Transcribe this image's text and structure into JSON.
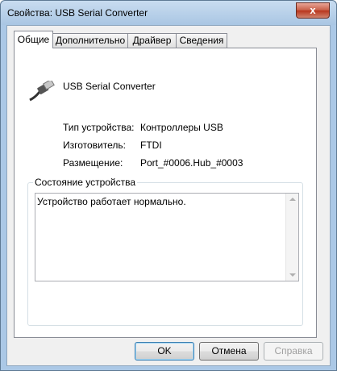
{
  "window": {
    "title": "Свойства: USB Serial Converter",
    "close_glyph": "x"
  },
  "tabs": [
    {
      "label": "Общие",
      "active": true
    },
    {
      "label": "Дополнительно",
      "active": false
    },
    {
      "label": "Драйвер",
      "active": false
    },
    {
      "label": "Сведения",
      "active": false
    }
  ],
  "device": {
    "name": "USB Serial Converter",
    "icon": "usb-plug-icon"
  },
  "properties": [
    {
      "label": "Тип устройства:",
      "value": "Контроллеры USB"
    },
    {
      "label": "Изготовитель:",
      "value": "FTDI"
    },
    {
      "label": "Размещение:",
      "value": "Port_#0006.Hub_#0003"
    }
  ],
  "status": {
    "legend": "Состояние устройства",
    "text": "Устройство работает нормально."
  },
  "buttons": {
    "ok": "OK",
    "cancel": "Отмена",
    "apply": "Справка"
  }
}
